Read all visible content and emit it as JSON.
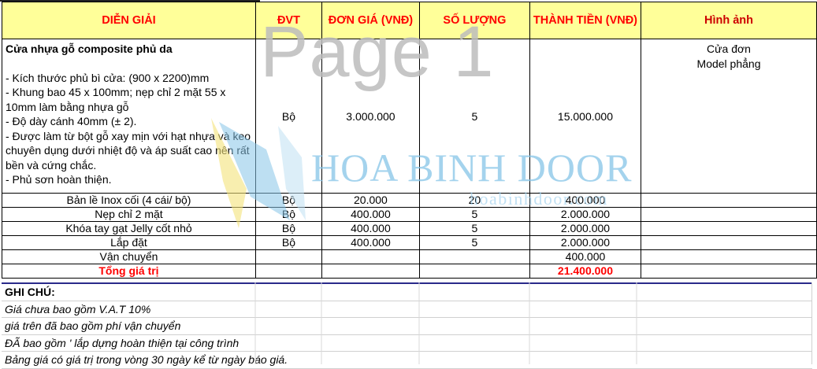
{
  "headers": {
    "description": "DIỄN GIẢI",
    "unit": "ĐVT",
    "unit_price": "ĐƠN GIÁ (VNĐ)",
    "quantity": "SỐ LƯỢNG",
    "amount": "THÀNH TIỀN (VNĐ)",
    "image": "Hình ảnh"
  },
  "main_item": {
    "title": "Cửa nhựa gỗ composite phủ da",
    "lines": [
      "- Kích thước phủ bì cửa: (900 x 2200)mm",
      "- Khung bao 45 x 100mm; nẹp chỉ 2 mặt 55 x 10mm làm bằng nhựa gỗ",
      "- Độ dày cánh 40mm (± 2).",
      "- Được làm từ bột gỗ xay mịn với hạt nhựa và keo chuyên dụng dưới nhiệt độ và áp suất cao nên rất bền và cứng chắc.",
      "- Phủ sơn hoàn thiện."
    ],
    "unit": "Bộ",
    "unit_price": "3.000.000",
    "quantity": "5",
    "amount": "15.000.000",
    "image_line1": "Cửa đơn",
    "image_line2": "Model phẳng"
  },
  "items": [
    {
      "name": "Bản lề Inox cối (4 cái/ bộ)",
      "unit": "Bộ",
      "unit_price": "20.000",
      "quantity": "20",
      "amount": "400.000"
    },
    {
      "name": "Nẹp chỉ 2 mặt",
      "unit": "Bộ",
      "unit_price": "400.000",
      "quantity": "5",
      "amount": "2.000.000"
    },
    {
      "name": "Khóa tay gạt Jelly cốt nhỏ",
      "unit": "Bộ",
      "unit_price": "400.000",
      "quantity": "5",
      "amount": "2.000.000"
    },
    {
      "name": "Lắp đặt",
      "unit": "Bộ",
      "unit_price": "400.000",
      "quantity": "5",
      "amount": "2.000.000"
    },
    {
      "name": "Vận chuyển",
      "unit": "",
      "unit_price": "",
      "quantity": "",
      "amount": "400.000"
    }
  ],
  "total": {
    "label": "Tổng giá trị",
    "amount": "21.400.000"
  },
  "notes": {
    "heading": "GHI CHÚ:",
    "lines": [
      "Giá chưa bao gồm V.A.T 10%",
      "giá trên đã bao gồm phí vận chuyển",
      "ĐÃ bao gồm ' lắp dựng hoàn thiện tại công trình",
      "Bảng giá có giá trị trong vòng 30 ngày kể từ ngày báo giá."
    ]
  },
  "watermark": {
    "page_label": "Page 1",
    "brand": "HOA BINH DOOR",
    "url": "hoabinhdoor.com",
    "logo_icon": "door-logo-icon",
    "logo_colors": [
      "#86c5e8",
      "#f3e27a"
    ]
  }
}
